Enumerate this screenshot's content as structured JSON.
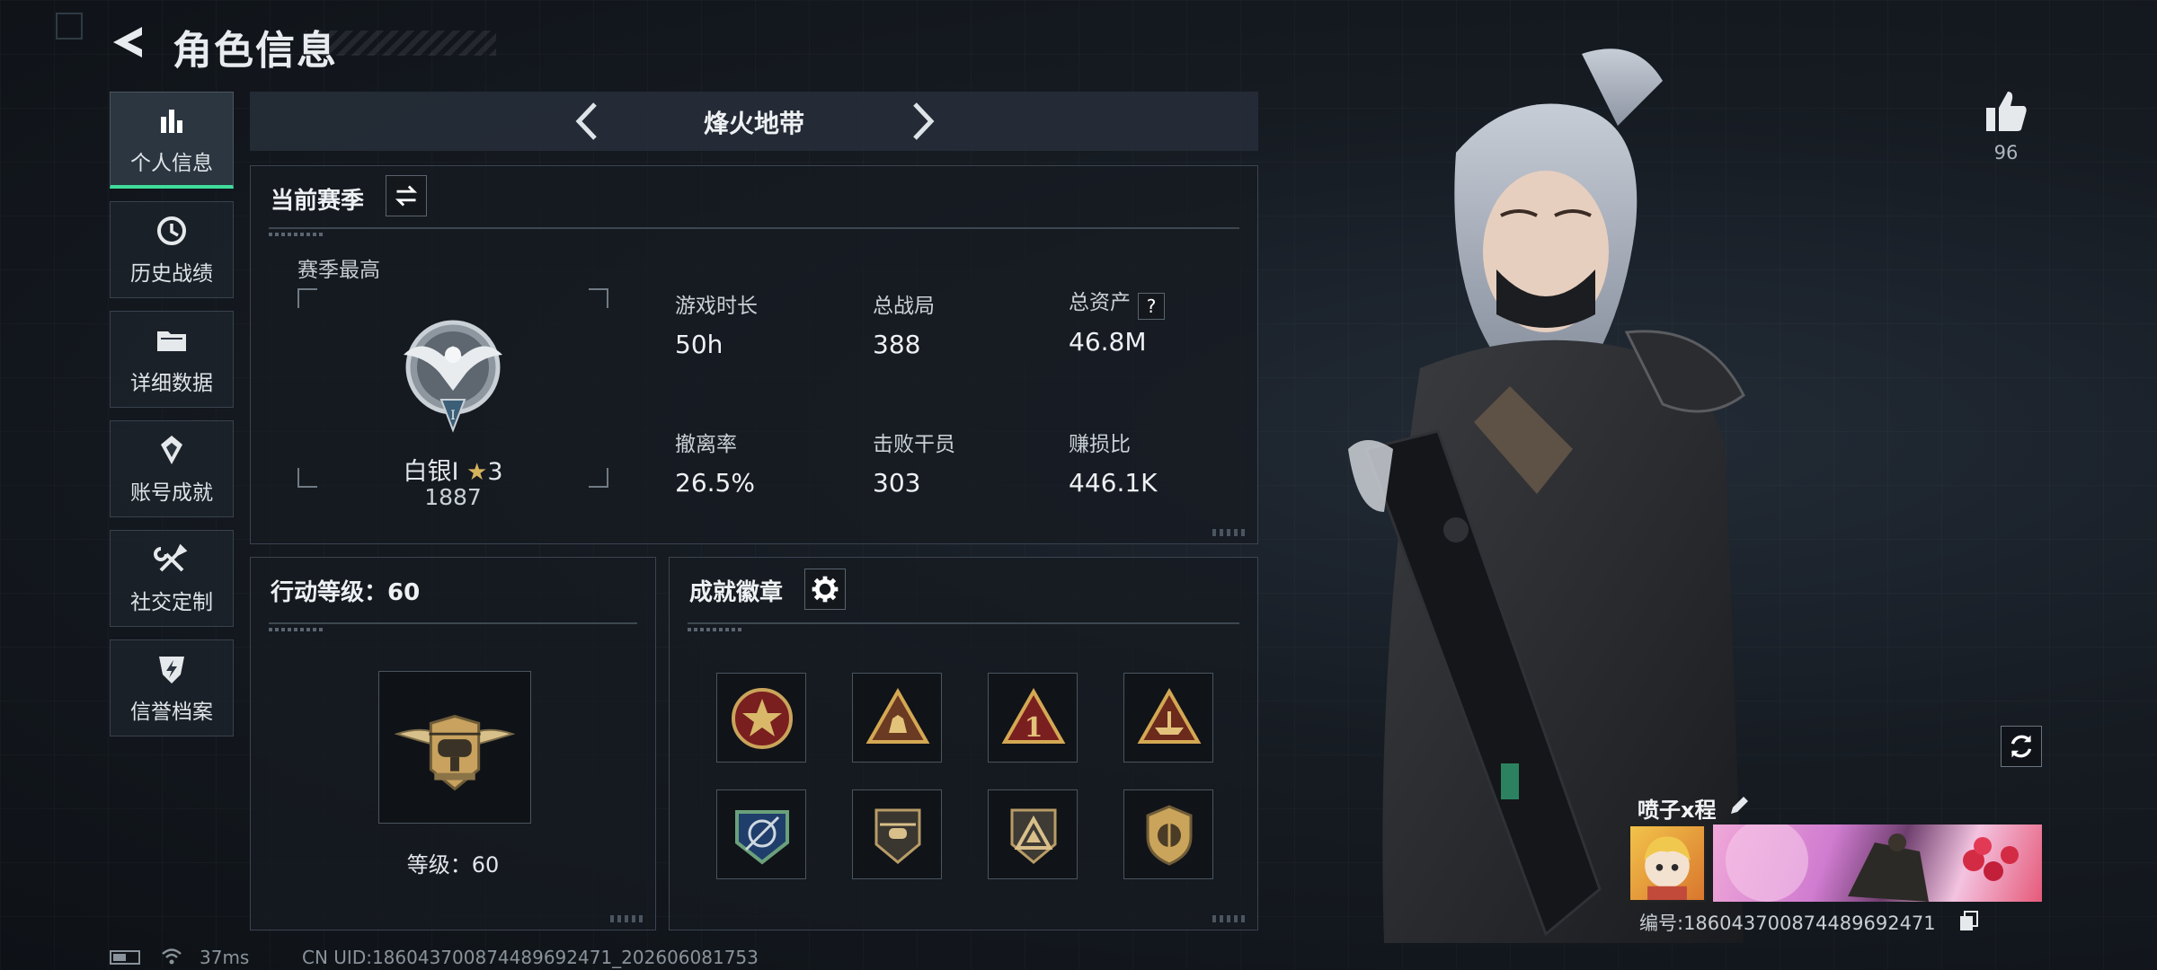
{
  "header": {
    "title": "角色信息",
    "back_icon": "back-arrow-icon"
  },
  "sidebar": {
    "items": [
      {
        "label": "个人信息",
        "icon": "bar-chart-icon",
        "active": true
      },
      {
        "label": "历史战绩",
        "icon": "history-clock-icon",
        "active": false
      },
      {
        "label": "详细数据",
        "icon": "folder-icon",
        "active": false
      },
      {
        "label": "账号成就",
        "icon": "achievement-icon",
        "active": false
      },
      {
        "label": "社交定制",
        "icon": "tools-icon",
        "active": false
      },
      {
        "label": "信誉档案",
        "icon": "shield-bolt-icon",
        "active": false
      }
    ]
  },
  "season_bar": {
    "title": "烽火地带"
  },
  "current_season": {
    "title": "当前赛季",
    "best_label": "赛季最高",
    "rank": {
      "name": "白银I",
      "stars": "3",
      "score": "1887"
    },
    "stats": [
      {
        "label": "游戏时长",
        "value": "50h"
      },
      {
        "label": "总战局",
        "value": "388"
      },
      {
        "label": "总资产",
        "value": "46.8M",
        "help": "?"
      },
      {
        "label": "撤离率",
        "value": "26.5%"
      },
      {
        "label": "击败干员",
        "value": "303"
      },
      {
        "label": "赚损比",
        "value": "446.1K"
      }
    ]
  },
  "action_level": {
    "title": "行动等级：60",
    "level_label": "等级：60"
  },
  "achievements": {
    "title": "成就徽章",
    "badges": [
      "star-shield-badge",
      "soldiers-triangle-badge",
      "number-one-triangle-badge",
      "ship-triangle-badge",
      "crosshair-badge",
      "helicopter-badge",
      "mountain-badge",
      "shield-circle-badge"
    ]
  },
  "right_panel": {
    "likes": "96",
    "player_name": "喷子x程",
    "player_id": "编号:1860437008744896924​71"
  },
  "status_bar": {
    "ping": "37ms",
    "uid": "CN UID:1860437008744896924​71_202606081753"
  },
  "colors": {
    "accent": "#3fdc9a",
    "gold": "#d6b45c",
    "panel_border": "#3a4450"
  }
}
